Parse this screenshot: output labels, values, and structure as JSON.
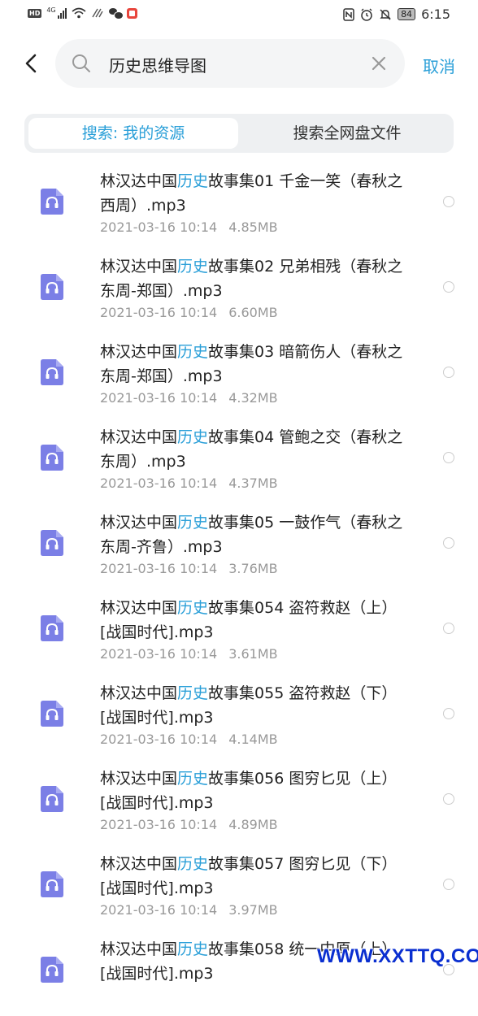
{
  "status_bar": {
    "left_badges": [
      "HD",
      "4G"
    ],
    "battery": "84",
    "time": "6:15"
  },
  "header": {
    "search_query": "历史思维导图",
    "cancel_label": "取消"
  },
  "tabs": {
    "mine_label": "搜索: 我的资源",
    "all_label": "搜索全网盘文件"
  },
  "accent_color": "#2a9fd8",
  "files": [
    {
      "prefix": "林汉达中国",
      "highlight": "历史",
      "suffix": "故事集01 千金一笑（春秋之西周）.mp3",
      "date": "2021-03-16 10:14",
      "size": "4.85MB"
    },
    {
      "prefix": "林汉达中国",
      "highlight": "历史",
      "suffix": "故事集02 兄弟相残（春秋之东周-郑国）.mp3",
      "date": "2021-03-16 10:14",
      "size": "6.60MB"
    },
    {
      "prefix": "林汉达中国",
      "highlight": "历史",
      "suffix": "故事集03 暗箭伤人（春秋之东周-郑国）.mp3",
      "date": "2021-03-16 10:14",
      "size": "4.32MB"
    },
    {
      "prefix": "林汉达中国",
      "highlight": "历史",
      "suffix": "故事集04 管鲍之交（春秋之东周）.mp3",
      "date": "2021-03-16 10:14",
      "size": "4.37MB"
    },
    {
      "prefix": "林汉达中国",
      "highlight": "历史",
      "suffix": "故事集05 一鼓作气（春秋之东周-齐鲁）.mp3",
      "date": "2021-03-16 10:14",
      "size": "3.76MB"
    },
    {
      "prefix": "林汉达中国",
      "highlight": "历史",
      "suffix": "故事集054 盗符救赵（上）[战国时代].mp3",
      "date": "2021-03-16 10:14",
      "size": "3.61MB"
    },
    {
      "prefix": "林汉达中国",
      "highlight": "历史",
      "suffix": "故事集055 盗符救赵（下）[战国时代].mp3",
      "date": "2021-03-16 10:14",
      "size": "4.14MB"
    },
    {
      "prefix": "林汉达中国",
      "highlight": "历史",
      "suffix": "故事集056 图穷匕见（上）[战国时代].mp3",
      "date": "2021-03-16 10:14",
      "size": "4.89MB"
    },
    {
      "prefix": "林汉达中国",
      "highlight": "历史",
      "suffix": "故事集057 图穷匕见（下）[战国时代].mp3",
      "date": "2021-03-16 10:14",
      "size": "3.97MB"
    },
    {
      "prefix": "林汉达中国",
      "highlight": "历史",
      "suffix": "故事集058 统一中原（上）[战国时代].mp3",
      "date": "",
      "size": ""
    }
  ],
  "watermark": "WWW.XXTTQ.COM"
}
